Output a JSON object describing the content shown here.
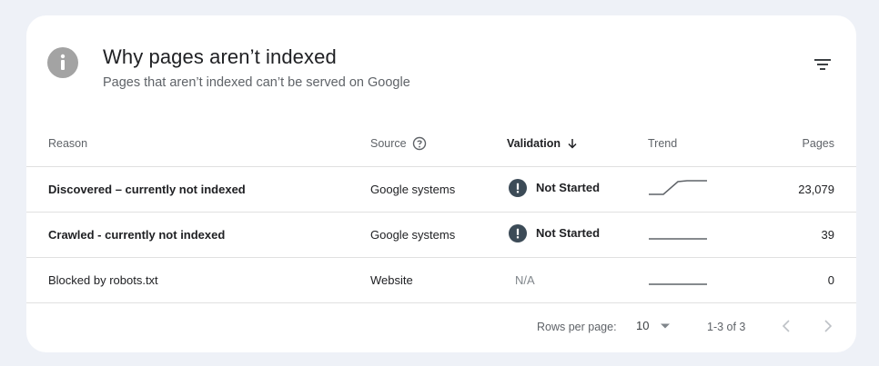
{
  "card": {
    "title": "Why pages aren’t indexed",
    "subtitle": "Pages that aren’t indexed can’t be served on Google",
    "icon": "info-icon",
    "filter_icon": "filter-icon"
  },
  "table": {
    "columns": {
      "reason": "Reason",
      "source": "Source",
      "validation": "Validation",
      "trend": "Trend",
      "pages": "Pages"
    },
    "sort": {
      "column": "validation",
      "direction": "descending"
    },
    "rows": [
      {
        "reason": "Discovered – currently not indexed",
        "source": "Google systems",
        "validation": "Not Started",
        "pages": "23,079",
        "bold": true,
        "trend": "rising"
      },
      {
        "reason": "Crawled - currently not indexed",
        "source": "Google systems",
        "validation": "Not Started",
        "pages": "39",
        "bold": true,
        "trend": "flat"
      },
      {
        "reason": "Blocked by robots.txt",
        "source": "Website",
        "validation": "N/A",
        "pages": "0",
        "bold": false,
        "trend": "flat"
      }
    ]
  },
  "footer": {
    "rows_per_page_label": "Rows per page:",
    "rows_per_page_value": "10",
    "range": "1-3 of 3"
  },
  "colors": {
    "background": "#eef1f7",
    "card": "#ffffff",
    "status_icon": "#3c4b57",
    "trend_line": "#5f6368"
  }
}
